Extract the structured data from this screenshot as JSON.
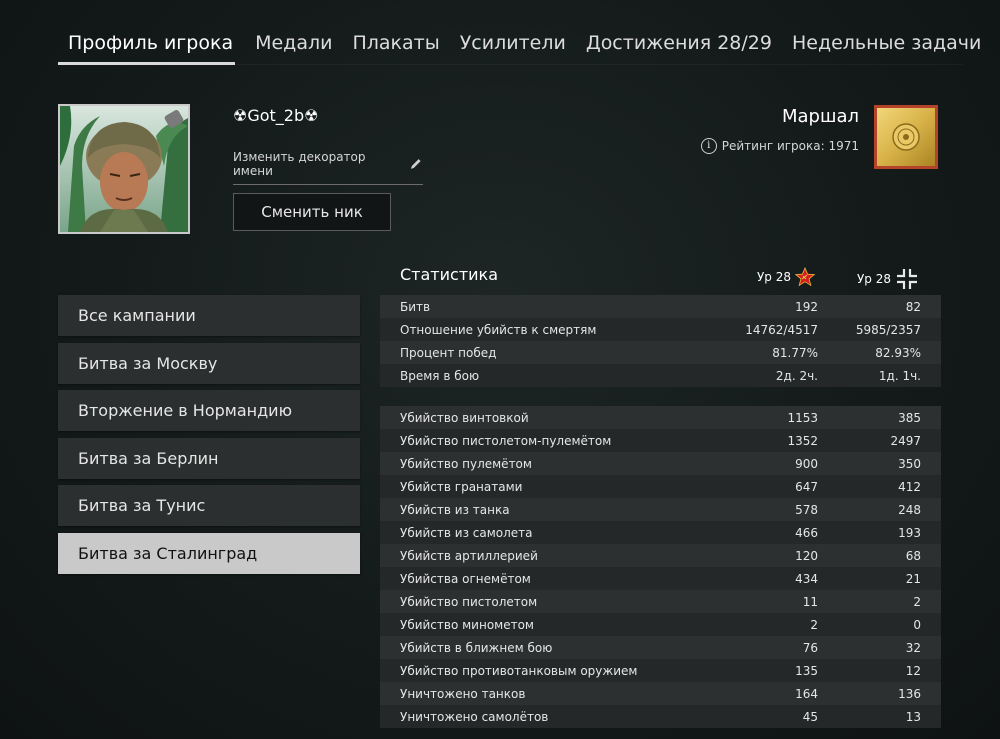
{
  "tabs": [
    {
      "label": "Профиль игрока",
      "active": true
    },
    {
      "label": "Медали"
    },
    {
      "label": "Плакаты"
    },
    {
      "label": "Усилители"
    },
    {
      "label": "Достижения 28/29"
    },
    {
      "label": "Недельные задачи"
    }
  ],
  "profile": {
    "nickname": "☢Got_2b☢",
    "decorator_label": "Изменить декоратор имени",
    "change_nick_label": "Сменить ник",
    "rank_title": "Маршал",
    "rating_label": "Рейтинг игрока: 1971"
  },
  "campaigns": [
    "Все кампании",
    "Битва за Москву",
    "Вторжение в Нормандию",
    "Битва за Берлин",
    "Битва за Тунис",
    "Битва за Сталинград"
  ],
  "selected_campaign": 5,
  "stats": {
    "title": "Статистика",
    "col1": "Ур 28",
    "col2": "Ур 28",
    "summary": [
      {
        "label": "Битв",
        "v1": "192",
        "v2": "82"
      },
      {
        "label": "Отношение убийств к смертям",
        "v1": "14762/4517",
        "v2": "5985/2357"
      },
      {
        "label": "Процент побед",
        "v1": "81.77%",
        "v2": "82.93%"
      },
      {
        "label": "Время в бою",
        "v1": "2д. 2ч.",
        "v2": "1д. 1ч."
      }
    ],
    "kills": [
      {
        "label": "Убийство винтовкой",
        "v1": "1153",
        "v2": "385"
      },
      {
        "label": "Убийство пистолетом-пулемётом",
        "v1": "1352",
        "v2": "2497"
      },
      {
        "label": "Убийство пулемётом",
        "v1": "900",
        "v2": "350"
      },
      {
        "label": "Убийств гранатами",
        "v1": "647",
        "v2": "412"
      },
      {
        "label": "Убийств из танка",
        "v1": "578",
        "v2": "248"
      },
      {
        "label": "Убийств из самолета",
        "v1": "466",
        "v2": "193"
      },
      {
        "label": "Убийств артиллерией",
        "v1": "120",
        "v2": "68"
      },
      {
        "label": "Убийства огнемётом",
        "v1": "434",
        "v2": "21"
      },
      {
        "label": "Убийство пистолетом",
        "v1": "11",
        "v2": "2"
      },
      {
        "label": "Убийство минометом",
        "v1": "2",
        "v2": "0"
      },
      {
        "label": "Убийств в ближнем бою",
        "v1": "76",
        "v2": "32"
      },
      {
        "label": "Убийство противотанковым оружием",
        "v1": "135",
        "v2": "12"
      },
      {
        "label": "Уничтожено танков",
        "v1": "164",
        "v2": "136"
      },
      {
        "label": "Уничтожено самолётов",
        "v1": "45",
        "v2": "13"
      }
    ]
  },
  "icons": {
    "info": "info-icon",
    "pencil": "pencil-icon",
    "ussr_star": "ussr-star-icon",
    "axis_cross": "axis-cross-icon",
    "rank_badge": "marshal-rank-badge"
  },
  "colors": {
    "selected_item": "#c9c9c9",
    "star_red": "#d11f1f",
    "badge_gold": "#d8b248"
  }
}
